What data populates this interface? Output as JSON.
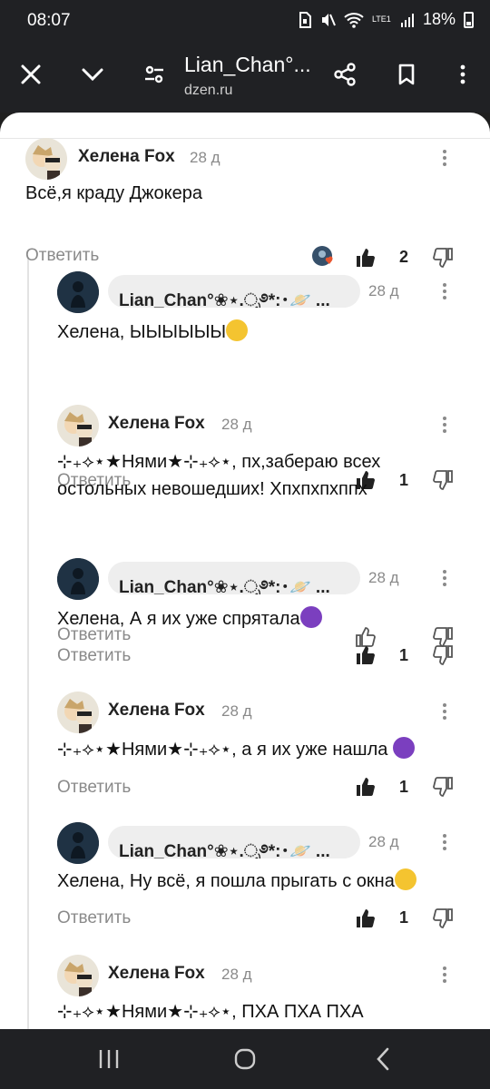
{
  "status": {
    "time": "08:07",
    "network": "LTE1",
    "battery": "18%"
  },
  "browser": {
    "title": "Lian_Chan°...",
    "url": "dzen.ru"
  },
  "actions": {
    "reply_label": "Ответить"
  },
  "comments": [
    {
      "author": "Хелена Fox",
      "date": "28 д",
      "text": "Всё,я краду Джокера",
      "likes": "2"
    },
    {
      "author": "Lian_Chan°❀⋆.ೃ࿔*:･🪐 ...",
      "date": "28 д",
      "text": "Хелена, ЫЫЫЫЫЫ",
      "likes": "1"
    },
    {
      "author": "Хелена Fox",
      "date": "28 д",
      "text": "⊹₊⟡⋆★Нями★⊹₊⟡⋆, пх,забераю всех остольных невошедших! Хпхпхпхппх",
      "likes": ""
    },
    {
      "author": "Lian_Chan°❀⋆.ೃ࿔*:･🪐 ...",
      "date": "28 д",
      "text": "Хелена, А я их уже спрятала",
      "likes": "1"
    },
    {
      "author": "Хелена Fox",
      "date": "28 д",
      "text": "⊹₊⟡⋆★Нями★⊹₊⟡⋆, а я их уже нашла",
      "likes": "1"
    },
    {
      "author": "Lian_Chan°❀⋆.ೃ࿔*:･🪐 ...",
      "date": "28 д",
      "text": "Хелена, Ну всё, я пошла прыгать с окна",
      "likes": "1"
    },
    {
      "author": "Хелена Fox",
      "date": "28 д",
      "text": "⊹₊⟡⋆★Нями★⊹₊⟡⋆, ПХА ПХА ПХА",
      "likes": ""
    }
  ],
  "icons": {
    "close": "close-icon",
    "collapse": "chevron-down-icon",
    "settings": "tune-icon",
    "share": "share-icon",
    "bookmark": "bookmark-icon",
    "menu": "more-vertical-icon",
    "like": "thumb-up-icon",
    "dislike": "thumb-down-icon"
  }
}
